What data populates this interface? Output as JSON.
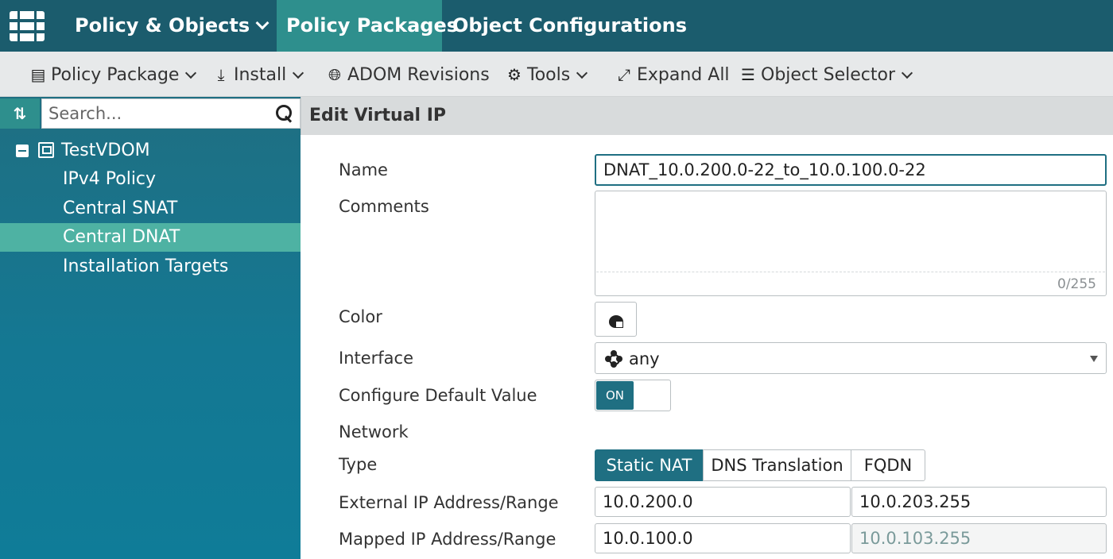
{
  "topnav": {
    "policy_objects": "Policy & Objects",
    "policy_packages": "Policy Packages",
    "object_configurations": "Object Configurations"
  },
  "toolbar": {
    "policy_package": "Policy Package",
    "install": "Install",
    "adom_revisions": "ADOM Revisions",
    "tools": "Tools",
    "expand_all": "Expand All",
    "object_selector": "Object Selector"
  },
  "sidebar": {
    "search_placeholder": "Search...",
    "root": "TestVDOM",
    "items": [
      {
        "label": "IPv4 Policy"
      },
      {
        "label": "Central SNAT"
      },
      {
        "label": "Central DNAT"
      },
      {
        "label": "Installation Targets"
      }
    ]
  },
  "form": {
    "title": "Edit Virtual IP",
    "name_label": "Name",
    "name_value": "DNAT_10.0.200.0-22_to_10.0.100.0-22",
    "comments_label": "Comments",
    "comments_value": "",
    "char_count": "0/255",
    "color_label": "Color",
    "interface_label": "Interface",
    "interface_value": "any",
    "default_label": "Configure Default Value",
    "default_toggle": "ON",
    "network_label": "Network",
    "type_label": "Type",
    "type_options": [
      "Static NAT",
      "DNS Translation",
      "FQDN"
    ],
    "external_label": "External IP Address/Range",
    "external_start": "10.0.200.0",
    "external_end": "10.0.203.255",
    "mapped_label": "Mapped IP Address/Range",
    "mapped_start": "10.0.100.0",
    "mapped_end": "10.0.103.255"
  },
  "colors": {
    "topbar": "#1b5c6d",
    "accent": "#2e8f8d",
    "sidebar_active": "#4eb2a3",
    "primary": "#1f6f82"
  }
}
